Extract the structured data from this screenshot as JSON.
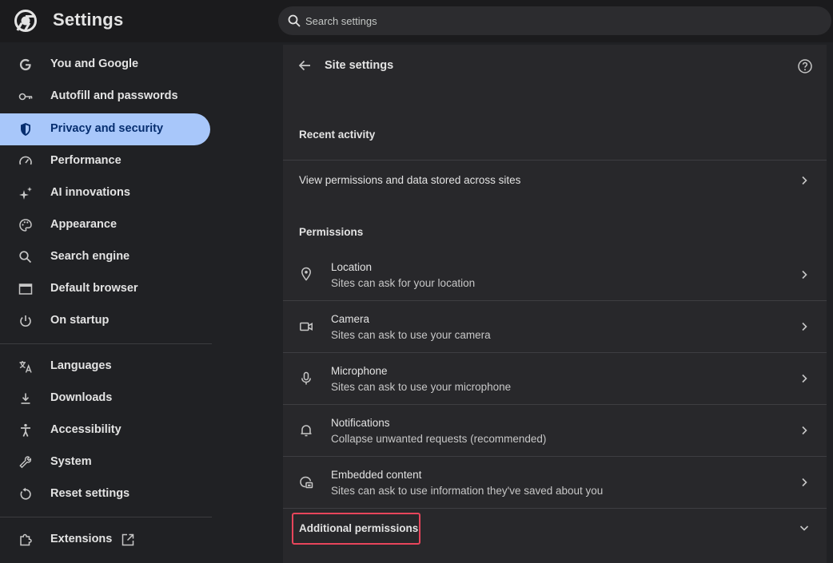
{
  "app": {
    "title": "Settings"
  },
  "search": {
    "placeholder": "Search settings",
    "value": ""
  },
  "sidebar": {
    "items": [
      {
        "label": "You and Google",
        "icon": "google-g-icon"
      },
      {
        "label": "Autofill and passwords",
        "icon": "key-icon"
      },
      {
        "label": "Privacy and security",
        "icon": "shield-icon",
        "active": true
      },
      {
        "label": "Performance",
        "icon": "speedometer-icon"
      },
      {
        "label": "AI innovations",
        "icon": "sparkle-icon"
      },
      {
        "label": "Appearance",
        "icon": "palette-icon"
      },
      {
        "label": "Search engine",
        "icon": "search-icon"
      },
      {
        "label": "Default browser",
        "icon": "browser-window-icon"
      },
      {
        "label": "On startup",
        "icon": "power-icon"
      },
      {
        "label": "Languages",
        "icon": "translate-icon"
      },
      {
        "label": "Downloads",
        "icon": "download-icon"
      },
      {
        "label": "Accessibility",
        "icon": "accessibility-icon"
      },
      {
        "label": "System",
        "icon": "wrench-icon"
      },
      {
        "label": "Reset settings",
        "icon": "reset-icon"
      },
      {
        "label": "Extensions",
        "icon": "puzzle-icon",
        "external_icon": "open-in-new-icon"
      }
    ]
  },
  "panel": {
    "title": "Site settings",
    "recent_activity_heading": "Recent activity",
    "view_permissions_label": "View permissions and data stored across sites",
    "permissions_heading": "Permissions",
    "permissions": [
      {
        "title": "Location",
        "subtitle": "Sites can ask for your location",
        "icon": "location-pin-icon"
      },
      {
        "title": "Camera",
        "subtitle": "Sites can ask to use your camera",
        "icon": "camera-icon"
      },
      {
        "title": "Microphone",
        "subtitle": "Sites can ask to use your microphone",
        "icon": "microphone-icon"
      },
      {
        "title": "Notifications",
        "subtitle": "Collapse unwanted requests (recommended)",
        "icon": "bell-icon"
      },
      {
        "title": "Embedded content",
        "subtitle": "Sites can ask to use information they've saved about you",
        "icon": "embedded-content-icon"
      }
    ],
    "additional_permissions_label": "Additional permissions"
  },
  "colors": {
    "background": "#202124",
    "panel": "#28282b",
    "active_nav": "#a8c7fa",
    "highlight_box": "#e8455b"
  }
}
